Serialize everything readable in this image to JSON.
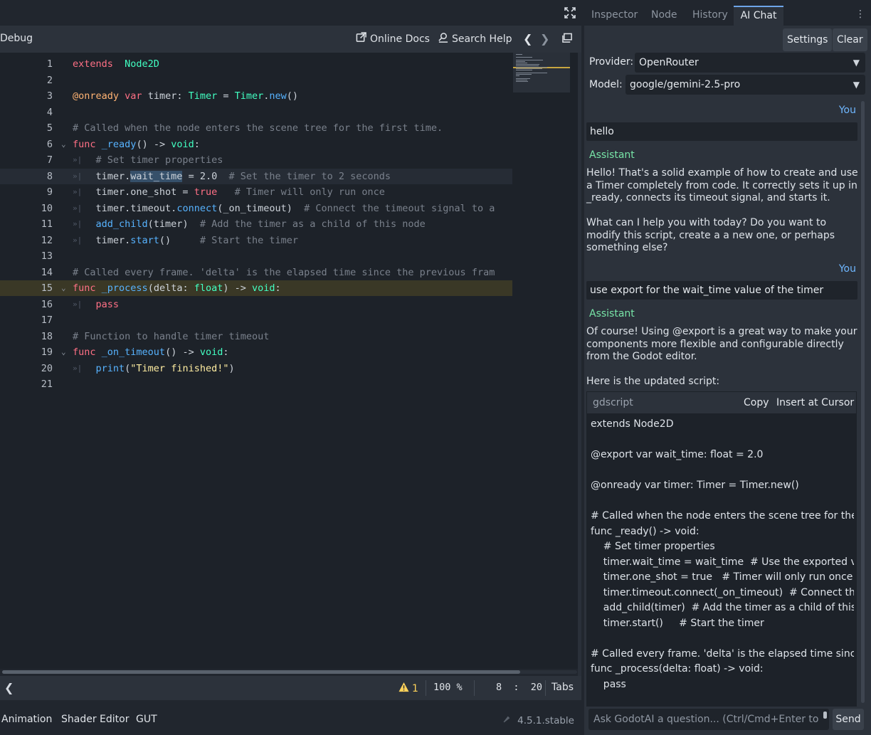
{
  "editor": {
    "menu_debug": "Debug",
    "online_docs": "Online Docs",
    "search_help": "Search Help",
    "prev": "❮",
    "next": "❯",
    "lines": [
      {
        "n": "1",
        "segs": [
          [
            "kw",
            "extends"
          ],
          [
            "",
            "  "
          ],
          [
            "ty",
            "Node2D"
          ]
        ]
      },
      {
        "n": "2",
        "segs": []
      },
      {
        "n": "3",
        "segs": [
          [
            "an",
            "@onready"
          ],
          [
            "",
            " "
          ],
          [
            "kw",
            "var"
          ],
          [
            "",
            " timer: "
          ],
          [
            "ty",
            "Timer"
          ],
          [
            "",
            " = "
          ],
          [
            "ty",
            "Timer"
          ],
          [
            "",
            "."
          ],
          [
            "fn",
            "new"
          ],
          [
            "",
            "()"
          ]
        ]
      },
      {
        "n": "4",
        "segs": []
      },
      {
        "n": "5",
        "segs": [
          [
            "cm",
            "# Called when the node enters the scene tree for the first time."
          ]
        ]
      },
      {
        "n": "6",
        "fold": true,
        "segs": [
          [
            "kw",
            "func"
          ],
          [
            "",
            " "
          ],
          [
            "fn",
            "_ready"
          ],
          [
            "",
            "() -> "
          ],
          [
            "ty",
            "void"
          ],
          [
            "",
            ":"
          ]
        ]
      },
      {
        "n": "7",
        "indent": true,
        "segs": [
          [
            "",
            "    "
          ],
          [
            "cm",
            "# Set timer properties"
          ]
        ]
      },
      {
        "n": "8",
        "indent": true,
        "current": true,
        "segs": [
          [
            "",
            "    timer."
          ],
          [
            "sel",
            "wait_time"
          ],
          [
            "",
            " = 2.0  "
          ],
          [
            "cm",
            "# Set the timer to 2 seconds"
          ]
        ]
      },
      {
        "n": "9",
        "indent": true,
        "segs": [
          [
            "",
            "    timer.one_shot = "
          ],
          [
            "kw",
            "true"
          ],
          [
            "",
            "   "
          ],
          [
            "cm",
            "# Timer will only run once"
          ]
        ]
      },
      {
        "n": "10",
        "indent": true,
        "segs": [
          [
            "",
            "    timer.timeout."
          ],
          [
            "fn",
            "connect"
          ],
          [
            "",
            "(_on_timeout)  "
          ],
          [
            "cm",
            "# Connect the timeout signal to a"
          ]
        ]
      },
      {
        "n": "11",
        "indent": true,
        "segs": [
          [
            "",
            "    "
          ],
          [
            "fn",
            "add_child"
          ],
          [
            "",
            "(timer)  "
          ],
          [
            "cm",
            "# Add the timer as a child of this node"
          ]
        ]
      },
      {
        "n": "12",
        "indent": true,
        "segs": [
          [
            "",
            "    timer."
          ],
          [
            "fn",
            "start"
          ],
          [
            "",
            "()     "
          ],
          [
            "cm",
            "# Start the timer"
          ]
        ]
      },
      {
        "n": "13",
        "segs": []
      },
      {
        "n": "14",
        "segs": [
          [
            "cm",
            "# Called every frame. 'delta' is the elapsed time since the previous fram"
          ]
        ]
      },
      {
        "n": "15",
        "fold": true,
        "hl": true,
        "segs": [
          [
            "kw",
            "func"
          ],
          [
            "",
            " "
          ],
          [
            "fn",
            "_process"
          ],
          [
            "",
            "(delta: "
          ],
          [
            "ty",
            "float"
          ],
          [
            "",
            ") -> "
          ],
          [
            "ty",
            "void"
          ],
          [
            "",
            ":"
          ]
        ]
      },
      {
        "n": "16",
        "indent": true,
        "segs": [
          [
            "",
            "    "
          ],
          [
            "kw",
            "pass"
          ]
        ]
      },
      {
        "n": "17",
        "segs": []
      },
      {
        "n": "18",
        "segs": [
          [
            "cm",
            "# Function to handle timer timeout"
          ]
        ]
      },
      {
        "n": "19",
        "fold": true,
        "segs": [
          [
            "kw",
            "func"
          ],
          [
            "",
            " "
          ],
          [
            "fn",
            "_on_timeout"
          ],
          [
            "",
            "() -> "
          ],
          [
            "ty",
            "void"
          ],
          [
            "",
            ":"
          ]
        ]
      },
      {
        "n": "20",
        "indent": true,
        "segs": [
          [
            "",
            "    "
          ],
          [
            "fn",
            "print"
          ],
          [
            "",
            "("
          ],
          [
            "st",
            "\"Timer finished!\""
          ],
          [
            "",
            ")"
          ]
        ]
      },
      {
        "n": "21",
        "segs": []
      }
    ],
    "status": {
      "warnings": "1",
      "zoom": "100 %",
      "cursor": "8  :  20",
      "indent_mode": "Tabs"
    }
  },
  "bottom_tabs": {
    "animation": "Animation",
    "shader": "Shader Editor",
    "gut": "GUT",
    "version": "4.5.1.stable"
  },
  "dock": {
    "tabs": {
      "inspector": "Inspector",
      "node": "Node",
      "history": "History",
      "ai_chat": "AI Chat"
    },
    "settings": "Settings",
    "clear": "Clear",
    "provider_label": "Provider:",
    "provider_value": "OpenRouter",
    "model_label": "Model:",
    "model_value": "google/gemini-2.5-pro",
    "you_label": "You",
    "assistant_label": "Assistant",
    "msg1_user": "hello",
    "msg1_asst_p1": "Hello! That's a solid example of how to create and use a Timer completely from code. It correctly sets it up in _ready, connects its timeout signal, and starts it.",
    "msg1_asst_p2": "What can I help you with today? Do you want to modify this script, create a a new one, or perhaps something else?",
    "msg2_user": "use export for the wait_time value of the timer",
    "msg2_asst_p1": "Of course! Using @export is a great way to make your components more flexible and configurable directly from the Godot editor.",
    "msg2_asst_p2": "Here is the updated script:",
    "code_lang": "gdscript",
    "copy": "Copy",
    "insert": "Insert at Cursor",
    "code_lines": [
      "extends Node2D",
      "",
      "@export var wait_time: float = 2.0",
      "",
      "@onready var timer: Timer = Timer.new()",
      "",
      "# Called when the node enters the scene tree for the fir",
      "func _ready() -> void:",
      "    # Set timer properties",
      "    timer.wait_time = wait_time  # Use the exported varia",
      "    timer.one_shot = true   # Timer will only run once",
      "    timer.timeout.connect(_on_timeout)  # Connect the ti",
      "    add_child(timer)  # Add the timer as a child of this no",
      "    timer.start()     # Start the timer",
      "",
      "# Called every frame. 'delta' is the elapsed time since th",
      "func _process(delta: float) -> void:",
      "    pass"
    ],
    "input_placeholder": "Ask GodotAI a question... (Ctrl/Cmd+Enter to",
    "send": "Send"
  }
}
